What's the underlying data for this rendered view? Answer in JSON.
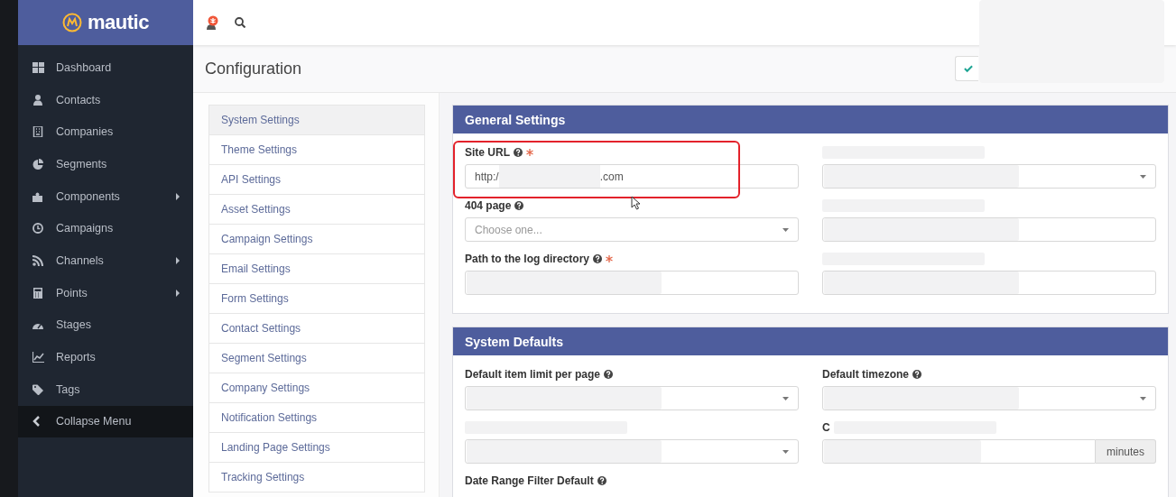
{
  "brand": {
    "name": "mautic"
  },
  "sidebar": {
    "items": [
      {
        "label": "Dashboard",
        "has_submenu": false
      },
      {
        "label": "Contacts",
        "has_submenu": false
      },
      {
        "label": "Companies",
        "has_submenu": false
      },
      {
        "label": "Segments",
        "has_submenu": false
      },
      {
        "label": "Components",
        "has_submenu": true
      },
      {
        "label": "Campaigns",
        "has_submenu": false
      },
      {
        "label": "Channels",
        "has_submenu": true
      },
      {
        "label": "Points",
        "has_submenu": true
      },
      {
        "label": "Stages",
        "has_submenu": false
      },
      {
        "label": "Reports",
        "has_submenu": false
      },
      {
        "label": "Tags",
        "has_submenu": false
      }
    ],
    "collapse_label": "Collapse Menu"
  },
  "page": {
    "title": "Configuration"
  },
  "settings_nav": [
    {
      "label": "System Settings",
      "selected": true
    },
    {
      "label": "Theme Settings",
      "selected": false
    },
    {
      "label": "API Settings",
      "selected": false
    },
    {
      "label": "Asset Settings",
      "selected": false
    },
    {
      "label": "Campaign Settings",
      "selected": false
    },
    {
      "label": "Email Settings",
      "selected": false
    },
    {
      "label": "Form Settings",
      "selected": false
    },
    {
      "label": "Contact Settings",
      "selected": false
    },
    {
      "label": "Segment Settings",
      "selected": false
    },
    {
      "label": "Company Settings",
      "selected": false
    },
    {
      "label": "Notification Settings",
      "selected": false
    },
    {
      "label": "Landing Page Settings",
      "selected": false
    },
    {
      "label": "Tracking Settings",
      "selected": false
    }
  ],
  "sections": [
    {
      "title": "General Settings",
      "fields": [
        {
          "label": "Site URL",
          "help": true,
          "required": true,
          "kind": "text",
          "value_start": "http:/",
          "value_end": ".com"
        },
        {
          "kind": "select",
          "redacted": true
        },
        {
          "label": "404 page",
          "help": true,
          "kind": "select",
          "placeholder": "Choose one..."
        },
        {
          "kind": "text",
          "redacted": true
        },
        {
          "label": "Path to the log directory",
          "help": true,
          "required": true,
          "kind": "text",
          "redacted": true
        },
        {
          "kind": "text",
          "redacted": true
        }
      ]
    },
    {
      "title": "System Defaults",
      "fields": [
        {
          "label": "Default item limit per page",
          "help": true,
          "kind": "select",
          "redacted": true
        },
        {
          "label": "Default timezone",
          "help": true,
          "kind": "select",
          "redacted": true
        },
        {
          "kind": "select",
          "redacted": true
        },
        {
          "label": "C",
          "label_redacted": true,
          "kind": "addon",
          "addon": "minutes",
          "redacted": true
        },
        {
          "label": "Date Range Filter Default",
          "help": true,
          "kind": "offscreen"
        }
      ]
    }
  ]
}
